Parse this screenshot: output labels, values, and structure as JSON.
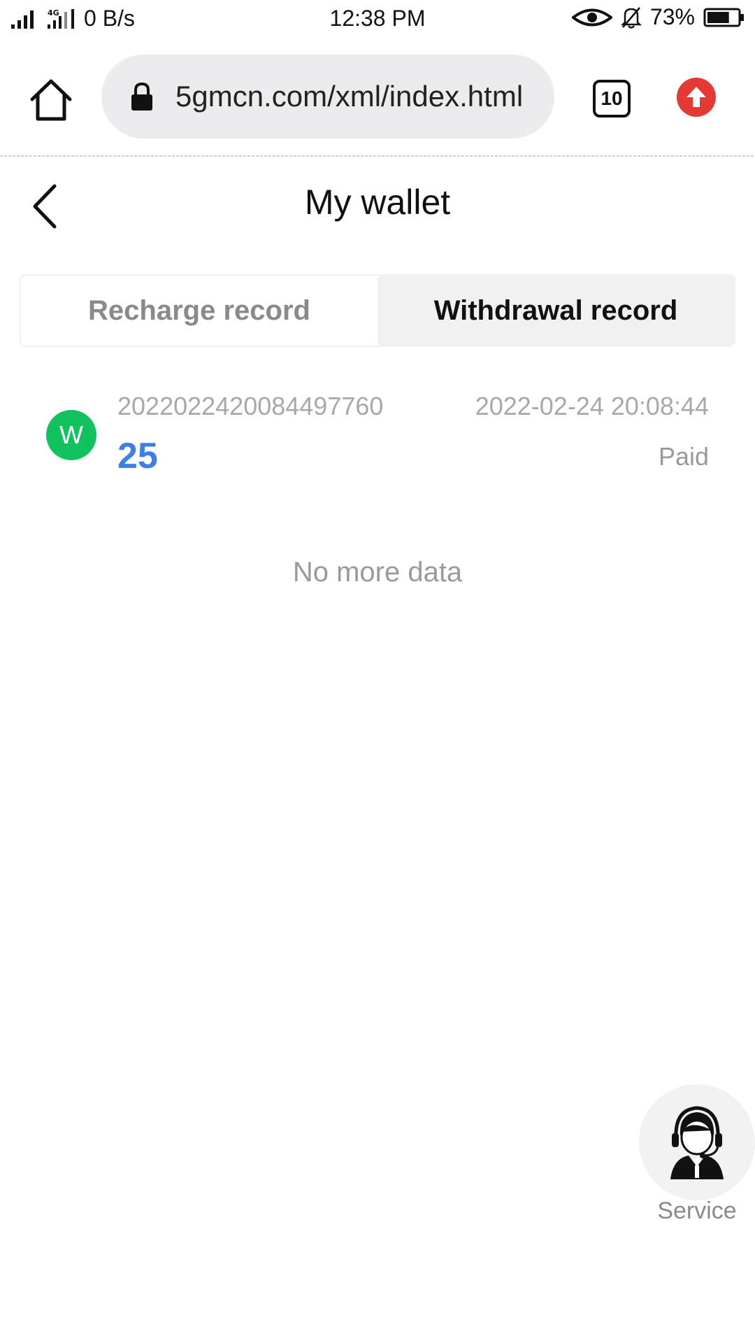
{
  "status_bar": {
    "network_speed": "0 B/s",
    "network_type": "4G",
    "time": "12:38 PM",
    "battery": "73%",
    "battery_level": 0.73,
    "icons": [
      "signal-icon",
      "eye-icon",
      "bell-off-icon",
      "battery-icon"
    ]
  },
  "browser": {
    "url": "5gmcn.com/xml/index.html",
    "tab_count": "10",
    "icons": [
      "home-icon",
      "lock-icon",
      "tabs-icon",
      "update-arrow-icon"
    ],
    "update_color": "#e53935"
  },
  "header": {
    "title": "My wallet",
    "back_icon": "chevron-left-icon"
  },
  "tabs": [
    {
      "label": "Recharge record",
      "active": false
    },
    {
      "label": "Withdrawal record",
      "active": true
    }
  ],
  "records": [
    {
      "avatar_letter": "W",
      "avatar_color": "#12c25e",
      "order_id": "2022022420084497760",
      "date": "2022-02-24 20:08:44",
      "amount": "25",
      "amount_color": "#3d7fe6",
      "status": "Paid"
    }
  ],
  "list_footer": "No more data",
  "service": {
    "label": "Service",
    "icon": "customer-service-agent-icon"
  }
}
